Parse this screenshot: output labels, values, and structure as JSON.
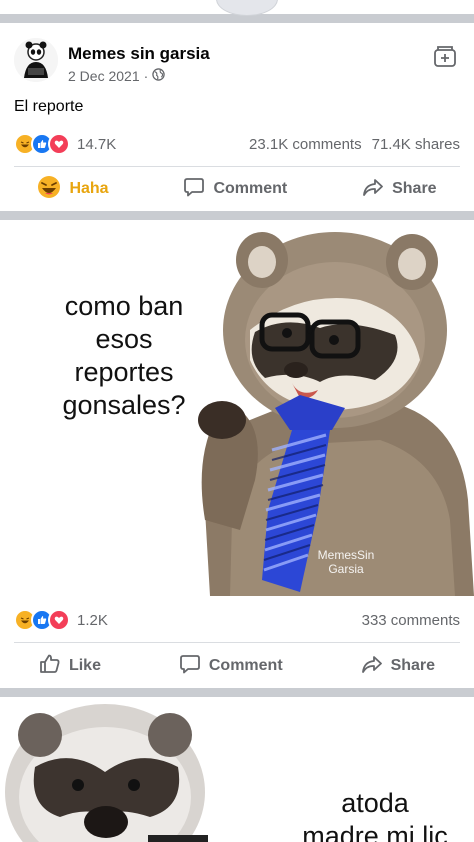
{
  "post1": {
    "page_name": "Memes sin garsia",
    "date": "2 Dec 2021",
    "date_separator": "·",
    "caption": "El reporte",
    "reaction_count": "14.7K",
    "comments": "23.1K comments",
    "shares": "71.4K shares",
    "actions": {
      "react": "Haha",
      "comment": "Comment",
      "share": "Share"
    }
  },
  "post2": {
    "meme_text": [
      "como ban",
      "esos",
      "reportes",
      "gonsales?"
    ],
    "watermark": [
      "MemesSin",
      "Garsia"
    ],
    "reaction_count": "1.2K",
    "comments": "333 comments",
    "actions": {
      "like": "Like",
      "comment": "Comment",
      "share": "Share"
    }
  },
  "post3": {
    "meme_text": [
      "atoda",
      "madre mi lic"
    ]
  },
  "colors": {
    "haha": "#f7b125",
    "like": "#1877f2",
    "love": "#f33e58",
    "secondary_text": "#65676b",
    "divider": "#c9ccd1"
  },
  "icons": [
    "globe-icon",
    "save-icon",
    "haha-icon",
    "like-icon",
    "love-icon",
    "comment-icon",
    "share-icon",
    "thumbs-up-icon"
  ]
}
